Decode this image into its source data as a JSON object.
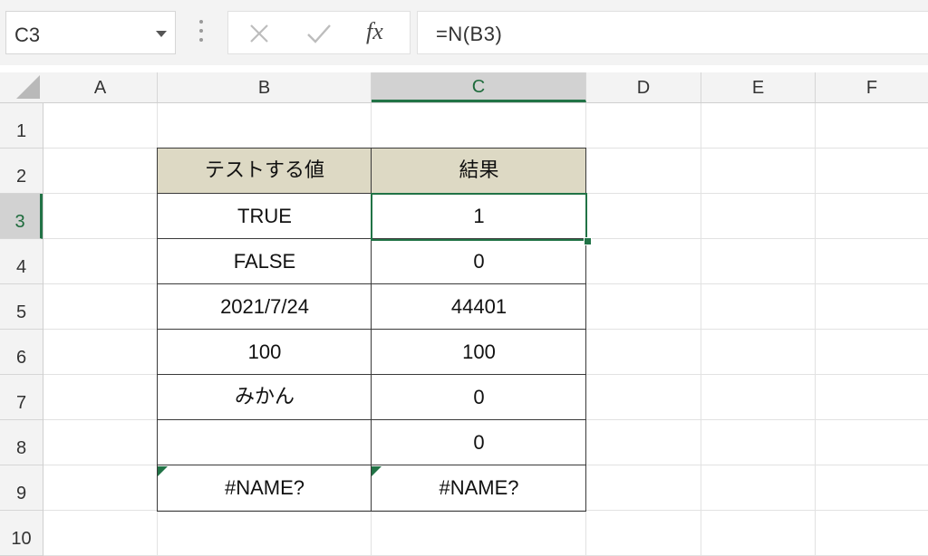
{
  "name_box": {
    "value": "C3"
  },
  "formula_bar": {
    "fx_label": "fx",
    "formula": "=N(B3)",
    "cancel_icon": "close-icon",
    "enter_icon": "check-icon"
  },
  "columns": [
    "A",
    "B",
    "C",
    "D",
    "E",
    "F"
  ],
  "active_column": "C",
  "rows": [
    "1",
    "2",
    "3",
    "4",
    "5",
    "6",
    "7",
    "8",
    "9",
    "10"
  ],
  "active_row": "3",
  "table": {
    "headers": [
      "テストする値",
      "結果"
    ],
    "rows": [
      [
        "TRUE",
        "1"
      ],
      [
        "FALSE",
        "0"
      ],
      [
        "2021/7/24",
        "44401"
      ],
      [
        "100",
        "100"
      ],
      [
        "みかん",
        "0"
      ],
      [
        "",
        "0"
      ],
      [
        "#NAME?",
        "#NAME?"
      ]
    ]
  },
  "colors": {
    "accent": "#217346",
    "table_header_fill": "#ddd9c4",
    "header_fill": "#f3f3f3"
  }
}
